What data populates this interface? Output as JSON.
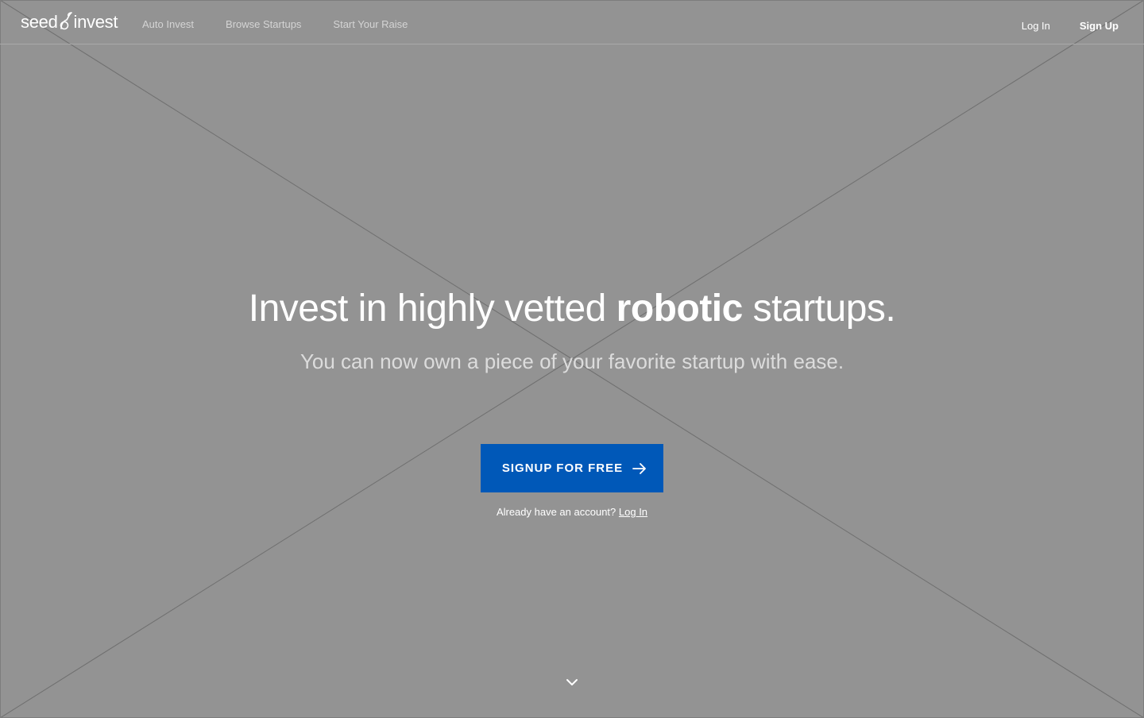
{
  "header": {
    "logo": {
      "text_left": "seed",
      "text_right": "invest"
    },
    "nav": [
      {
        "label": "Auto Invest"
      },
      {
        "label": "Browse Startups"
      },
      {
        "label": "Start Your Raise"
      }
    ],
    "login_label": "Log In",
    "signup_label": "Sign Up"
  },
  "hero": {
    "title_before": "Invest in highly vetted ",
    "title_emphasis": "robotic",
    "title_after": " startups.",
    "subtitle": "You can now own a piece of your favorite startup with ease.",
    "cta_label": "SIGNUP FOR FREE",
    "cta_icon": "arrow-right-icon",
    "already_text": "Already have an account?",
    "already_link": "Log In",
    "scroll_icon": "chevron-down-icon"
  },
  "colors": {
    "background": "#939393",
    "cta": "#0058b8",
    "text": "#ffffff"
  }
}
